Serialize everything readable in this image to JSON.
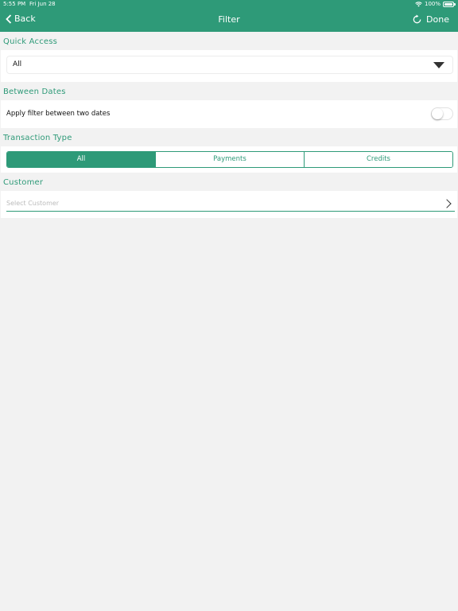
{
  "status_bar": {
    "time": "5:55 PM",
    "date": "Fri Jun 28",
    "battery": "100%"
  },
  "nav": {
    "back_label": "Back",
    "title": "Filter",
    "done_label": "Done"
  },
  "quick_access": {
    "label": "Quick Access",
    "selected": "All"
  },
  "between_dates": {
    "label": "Between Dates",
    "toggle_label": "Apply filter between two dates",
    "enabled": false
  },
  "transaction_type": {
    "label": "Transaction Type",
    "options": [
      "All",
      "Payments",
      "Credits"
    ],
    "selected": "All"
  },
  "customer": {
    "label": "Customer",
    "placeholder": "Select Customer"
  },
  "colors": {
    "accent": "#2e9a78",
    "background": "#f2f2f2"
  }
}
